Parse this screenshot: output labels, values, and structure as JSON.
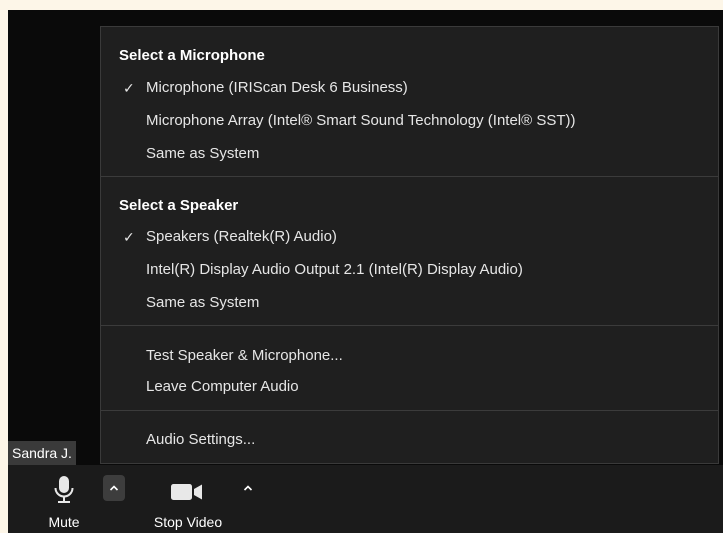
{
  "menu": {
    "microphone": {
      "heading": "Select a Microphone",
      "items": [
        {
          "label": "Microphone (IRIScan Desk 6 Business)",
          "checked": true
        },
        {
          "label": "Microphone Array (Intel® Smart Sound Technology (Intel® SST))",
          "checked": false
        },
        {
          "label": "Same as System",
          "checked": false
        }
      ]
    },
    "speaker": {
      "heading": "Select a Speaker",
      "items": [
        {
          "label": "Speakers (Realtek(R) Audio)",
          "checked": true
        },
        {
          "label": "Intel(R) Display Audio Output 2.1 (Intel(R) Display Audio)",
          "checked": false
        },
        {
          "label": "Same as System",
          "checked": false
        }
      ]
    },
    "actions": {
      "test": "Test Speaker & Microphone...",
      "leave": "Leave Computer Audio"
    },
    "settings": "Audio Settings..."
  },
  "check_glyph": "✓",
  "participant": {
    "name": "Sandra J."
  },
  "toolbar": {
    "mute_label": "Mute",
    "stop_video_label": "Stop Video"
  },
  "colors": {
    "menu_background": "#1f1f1f",
    "toolbar_background": "#1b1b1b",
    "caret_box": "#3d3d3d"
  },
  "icons": {
    "mute": "microphone-icon",
    "video": "video-camera-icon",
    "caret": "chevron-up-icon",
    "check": "checkmark-icon"
  }
}
